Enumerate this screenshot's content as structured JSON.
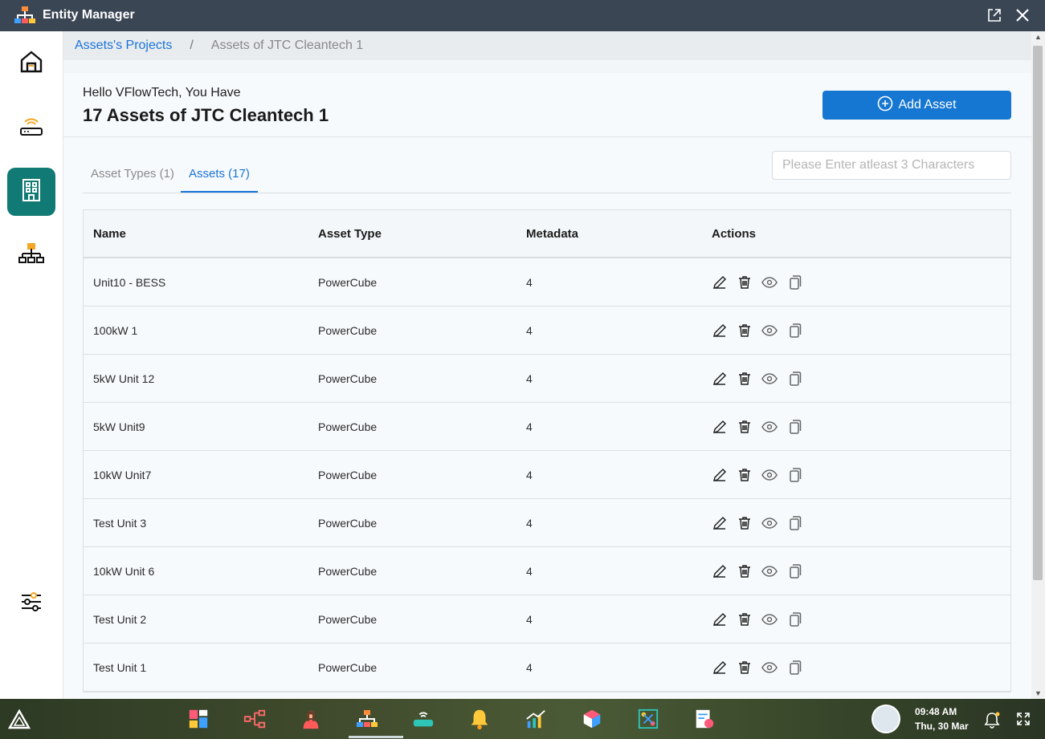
{
  "window": {
    "title": "Entity Manager"
  },
  "breadcrumb": {
    "parent": "Assets's Projects",
    "separator": "/",
    "current": "Assets of JTC Cleantech 1"
  },
  "header": {
    "greeting": "Hello VFlowTech, You Have",
    "count_title": "17 Assets of JTC Cleantech 1",
    "add_button": "Add Asset"
  },
  "tabs": [
    {
      "label": "Asset Types (1)"
    },
    {
      "label": "Assets (17)"
    }
  ],
  "search": {
    "placeholder": "Please Enter atleast 3 Characters",
    "value": ""
  },
  "table": {
    "headers": {
      "name": "Name",
      "type": "Asset Type",
      "metadata": "Metadata",
      "actions": "Actions"
    },
    "rows": [
      {
        "name": "Unit10 - BESS",
        "type": "PowerCube",
        "metadata": "4"
      },
      {
        "name": "100kW 1",
        "type": "PowerCube",
        "metadata": "4"
      },
      {
        "name": "5kW Unit 12",
        "type": "PowerCube",
        "metadata": "4"
      },
      {
        "name": "5kW Unit9",
        "type": "PowerCube",
        "metadata": "4"
      },
      {
        "name": "10kW Unit7",
        "type": "PowerCube",
        "metadata": "4"
      },
      {
        "name": "Test Unit 3",
        "type": "PowerCube",
        "metadata": "4"
      },
      {
        "name": "10kW Unit 6",
        "type": "PowerCube",
        "metadata": "4"
      },
      {
        "name": "Test Unit 2",
        "type": "PowerCube",
        "metadata": "4"
      },
      {
        "name": "Test Unit 1",
        "type": "PowerCube",
        "metadata": "4"
      }
    ],
    "row_actions": [
      "edit-icon",
      "trash-icon",
      "eye-icon",
      "copy-icon"
    ]
  },
  "sidebar": {
    "items": [
      "home-icon",
      "router-icon",
      "building-icon",
      "hierarchy-icon",
      "settings-sliders-icon"
    ],
    "active": "building-icon"
  },
  "taskbar": {
    "time": "09:48 AM",
    "date": "Thu, 30 Mar",
    "apps": [
      "dashboard-icon",
      "flow-icon",
      "user-icon",
      "entity-manager-icon",
      "device-icon",
      "alarm-icon",
      "analytics-icon",
      "cube-icon",
      "network-icon",
      "report-icon"
    ]
  },
  "colors": {
    "accent": "#1677d2",
    "active_side": "#117a74",
    "titlebar": "#3b4655"
  }
}
